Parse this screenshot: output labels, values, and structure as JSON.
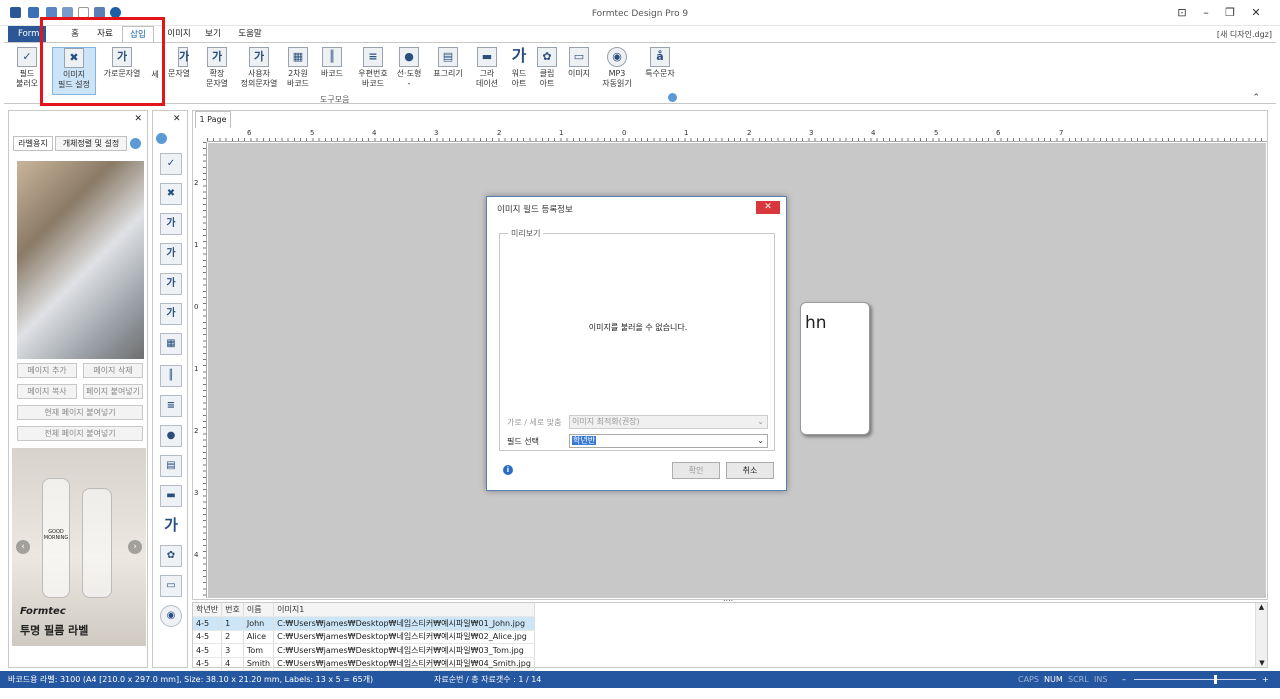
{
  "window": {
    "title": "Formtec Design Pro 9",
    "doc_name": "[새 디자인.dgz]"
  },
  "ribbon_tabs": [
    "Form",
    "홈",
    "자료",
    "삽입",
    "이미지",
    "보기",
    "도움말"
  ],
  "ribbon_buttons": [
    {
      "label": "필드\n불러오",
      "icon": "field-load-icon"
    },
    {
      "label": "이미지\n필드 설정",
      "icon": "image-field-icon"
    },
    {
      "label": "가로문자열",
      "icon": "horizontal-text-icon"
    },
    {
      "label": "세",
      "icon": "vertical-text-icon"
    },
    {
      "label": "문자열",
      "icon": "text-icon"
    },
    {
      "label": "확장\n문자열",
      "icon": "extended-text-icon"
    },
    {
      "label": "사용자\n정의문자열",
      "icon": "custom-text-icon"
    },
    {
      "label": "2차원\n바코드",
      "icon": "qr-code-icon"
    },
    {
      "label": "바코드",
      "icon": "barcode-icon"
    },
    {
      "label": "우편번호\n바코드",
      "icon": "postal-barcode-icon"
    },
    {
      "label": "선·도형\n-",
      "icon": "shape-icon"
    },
    {
      "label": "표그리기",
      "icon": "table-icon"
    },
    {
      "label": "그라\n데이션",
      "icon": "gradient-icon"
    },
    {
      "label": "워드\n아트",
      "icon": "wordart-icon"
    },
    {
      "label": "클립\n아트",
      "icon": "clipart-icon"
    },
    {
      "label": "이미지",
      "icon": "image-icon"
    },
    {
      "label": "MP3\n자동읽기",
      "icon": "mp3-icon"
    },
    {
      "label": "특수문자",
      "icon": "special-char-icon"
    }
  ],
  "ribbon_group": "도구모음",
  "left_panel": {
    "tabs": [
      "라벨용지",
      "개체정렬 및 설정"
    ],
    "buttons": [
      "페이지 추가",
      "페이지 삭제",
      "페이지 복사",
      "페이지 붙여넣기",
      "현재 페이지 붙여넣기",
      "전체 페이지 붙여넣기"
    ],
    "ad_brand": "Formtec",
    "ad_text": "투명 필름 라벨",
    "bottle_text": "GOOD\nMORNING"
  },
  "page_tab": "1 Page",
  "ruler": {
    "h": [
      "6",
      "5",
      "4",
      "3",
      "2",
      "1",
      "0",
      "1",
      "2",
      "3",
      "4",
      "5",
      "6",
      "7"
    ],
    "v": [
      "2",
      "1",
      "0",
      "1",
      "2",
      "3",
      "4"
    ]
  },
  "label_text": "hn",
  "dialog": {
    "title": "이미지 필드 등록정보",
    "close": "✕",
    "preview_legend": "미리보기",
    "preview_msg": "이미지를 불러올 수 없습니다.",
    "fit_label": "가로 / 세로 맞춤",
    "fit_value": "이미지 최적화(권장)",
    "field_label": "필드 선택",
    "field_value": "학년반",
    "ok": "확인",
    "cancel": "취소"
  },
  "grid": {
    "headers": [
      "학년반",
      "번호",
      "이름",
      "이미지1"
    ],
    "rows": [
      [
        "4-5",
        "1",
        "John",
        "C:₩Users₩james₩Desktop₩네임스티커₩예시파일₩01_John.jpg"
      ],
      [
        "4-5",
        "2",
        "Alice",
        "C:₩Users₩james₩Desktop₩네임스티커₩예시파일₩02_Alice.jpg"
      ],
      [
        "4-5",
        "3",
        "Tom",
        "C:₩Users₩james₩Desktop₩네임스티커₩예시파일₩03_Tom.jpg"
      ],
      [
        "4-5",
        "4",
        "Smith",
        "C:₩Users₩james₩Desktop₩네임스티커₩예시파일₩04_Smith.jpg"
      ]
    ]
  },
  "status": {
    "paper": "바코드용 라벨: 3100 (A4 [210.0 x 297.0 mm], Size: 38.10 x 21.20 mm, Labels: 13 x 5 = 65개)",
    "records": "자료순번 / 총 자료갯수 : 1 / 14",
    "indicators": [
      "CAPS",
      "NUM",
      "SCRL",
      "INS"
    ]
  },
  "colors": {
    "accent": "#2557a0",
    "highlight": "#e4141b",
    "selection": "#cde6f7"
  }
}
